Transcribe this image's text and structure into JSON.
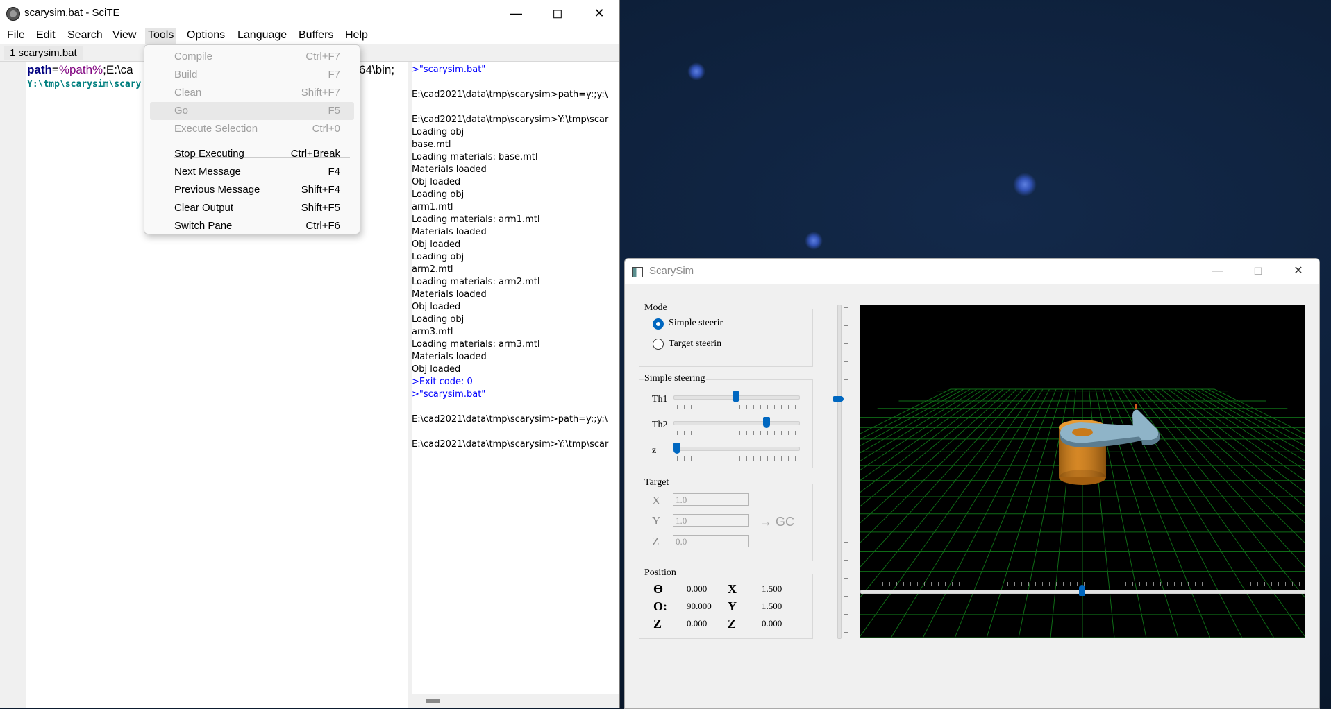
{
  "scite": {
    "title": "scarysim.bat - SciTE",
    "menu": [
      "File",
      "Edit",
      "Search",
      "View",
      "Tools",
      "Options",
      "Language",
      "Buffers",
      "Help"
    ],
    "tab": "1 scarysim.bat",
    "code_kw": "path",
    "code_eq": "=",
    "code_var": "%path%",
    "code_rest": ";E:\\ca",
    "code_tail": "64\\bin;",
    "code_line2": "Y:\\tmp\\scarysim\\scary",
    "output": [
      {
        "text": ">\"scarysim.bat\"",
        "blue": true
      },
      {
        "text": "",
        "blue": false
      },
      {
        "text": "E:\\cad2021\\data\\tmp\\scarysim>path=y:;y:\\",
        "blue": false
      },
      {
        "text": "",
        "blue": false
      },
      {
        "text": "E:\\cad2021\\data\\tmp\\scarysim>Y:\\tmp\\scar",
        "blue": false
      },
      {
        "text": "Loading obj",
        "blue": false
      },
      {
        "text": "base.mtl",
        "blue": false
      },
      {
        "text": "Loading materials: base.mtl",
        "blue": false
      },
      {
        "text": "Materials loaded",
        "blue": false
      },
      {
        "text": "Obj loaded",
        "blue": false
      },
      {
        "text": "Loading obj",
        "blue": false
      },
      {
        "text": "arm1.mtl",
        "blue": false
      },
      {
        "text": "Loading materials: arm1.mtl",
        "blue": false
      },
      {
        "text": "Materials loaded",
        "blue": false
      },
      {
        "text": "Obj loaded",
        "blue": false
      },
      {
        "text": "Loading obj",
        "blue": false
      },
      {
        "text": "arm2.mtl",
        "blue": false
      },
      {
        "text": "Loading materials: arm2.mtl",
        "blue": false
      },
      {
        "text": "Materials loaded",
        "blue": false
      },
      {
        "text": "Obj loaded",
        "blue": false
      },
      {
        "text": "Loading obj",
        "blue": false
      },
      {
        "text": "arm3.mtl",
        "blue": false
      },
      {
        "text": "Loading materials: arm3.mtl",
        "blue": false
      },
      {
        "text": "Materials loaded",
        "blue": false
      },
      {
        "text": "Obj loaded",
        "blue": false
      },
      {
        "text": ">Exit code: 0",
        "blue": true
      },
      {
        "text": ">\"scarysim.bat\"",
        "blue": true
      },
      {
        "text": "",
        "blue": false
      },
      {
        "text": "E:\\cad2021\\data\\tmp\\scarysim>path=y:;y:\\",
        "blue": false
      },
      {
        "text": "",
        "blue": false
      },
      {
        "text": "E:\\cad2021\\data\\tmp\\scarysim>Y:\\tmp\\scar",
        "blue": false
      }
    ]
  },
  "tools_menu": [
    {
      "label": "Compile",
      "shortcut": "Ctrl+F7",
      "disabled": true
    },
    {
      "label": "Build",
      "shortcut": "F7",
      "disabled": true
    },
    {
      "label": "Clean",
      "shortcut": "Shift+F7",
      "disabled": true
    },
    {
      "label": "Go",
      "shortcut": "F5",
      "disabled": true,
      "highlighted": true
    },
    {
      "label": "Execute Selection",
      "shortcut": "Ctrl+0",
      "disabled": true
    },
    {
      "label": "Stop Executing",
      "shortcut": "Ctrl+Break",
      "disabled": false
    },
    {
      "label": "Next Message",
      "shortcut": "F4",
      "disabled": false
    },
    {
      "label": "Previous Message",
      "shortcut": "Shift+F4",
      "disabled": false
    },
    {
      "label": "Clear Output",
      "shortcut": "Shift+F5",
      "disabled": false
    },
    {
      "label": "Switch Pane",
      "shortcut": "Ctrl+F6",
      "disabled": false
    }
  ],
  "sim": {
    "title": "ScarySim",
    "mode": {
      "title": "Mode",
      "simple": "Simple steerir",
      "target": "Target steerin",
      "selected": "simple"
    },
    "steering": {
      "title": "Simple steering",
      "sliders": [
        {
          "label": "Th1",
          "value": 0.5
        },
        {
          "label": "Th2",
          "value": 0.76
        },
        {
          "label": "z",
          "value": 0.0
        }
      ]
    },
    "target": {
      "title": "Target",
      "x_label": "X",
      "x_value": "1.0",
      "y_label": "Y",
      "y_value": "1.0",
      "z_label": "Z",
      "z_value": "0.0",
      "go_label": "→ GC"
    },
    "position": {
      "title": "Position",
      "rows": [
        {
          "a_label": "ϴ",
          "a_value": "0.000",
          "b_label": "X",
          "b_value": "1.500"
        },
        {
          "a_label": "ϴ:",
          "a_value": "90.000",
          "b_label": "Y",
          "b_value": "1.500"
        },
        {
          "a_label": "Z",
          "a_value": "0.000",
          "b_label": "Z",
          "b_value": "0.000"
        }
      ]
    },
    "vertical_slider_value": 0.72,
    "horizontal_slider_value": 0.5
  }
}
